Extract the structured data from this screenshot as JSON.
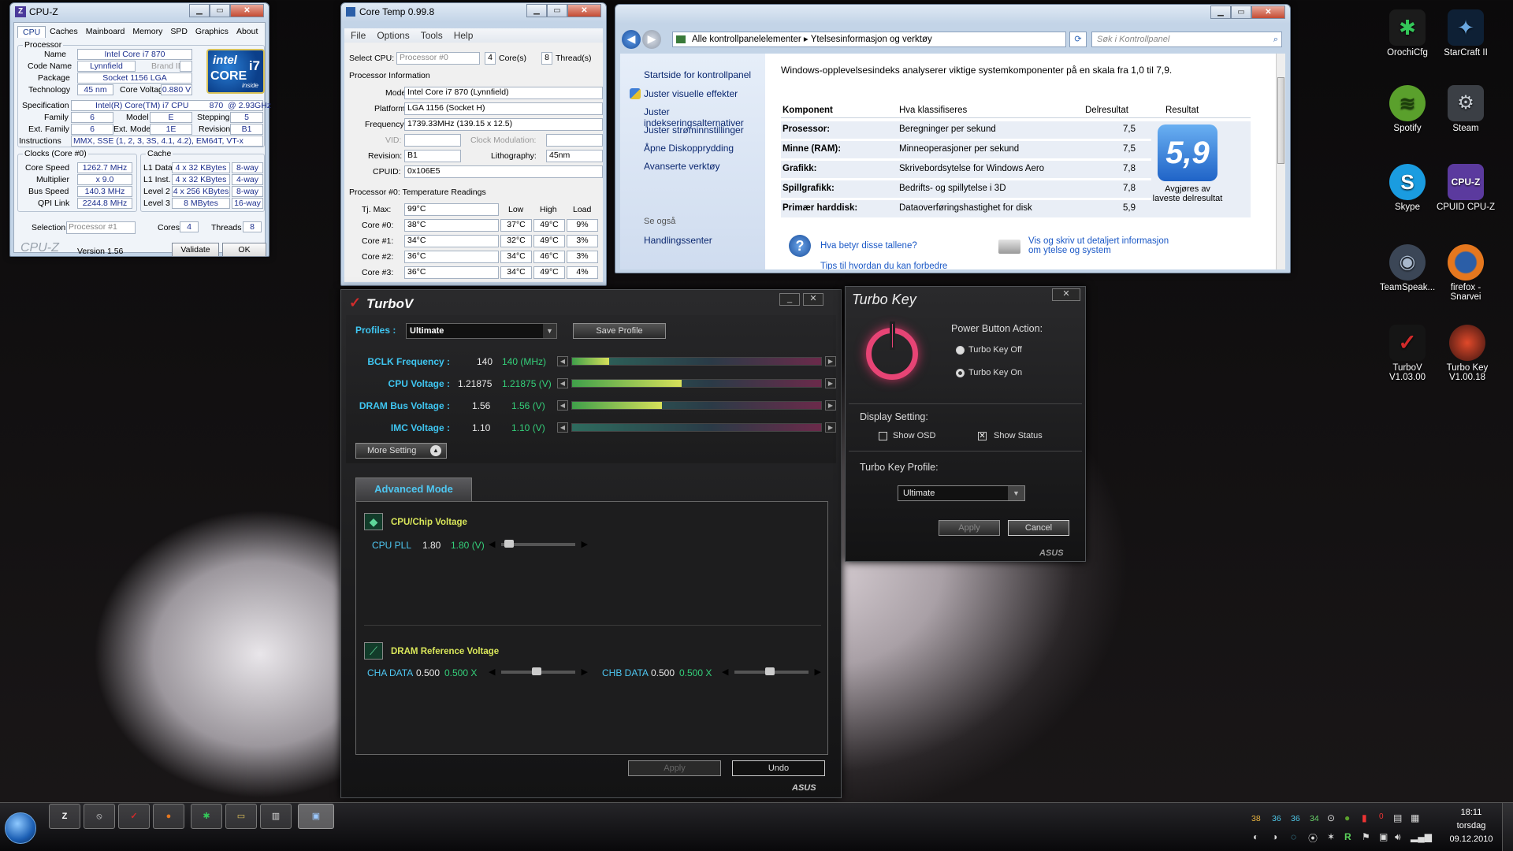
{
  "cpuz": {
    "title": "CPU-Z",
    "tabs": [
      "CPU",
      "Caches",
      "Mainboard",
      "Memory",
      "SPD",
      "Graphics",
      "About"
    ],
    "processor_group": "Processor",
    "name_l": "Name",
    "name": "Intel Core i7 870",
    "codename_l": "Code Name",
    "codename": "Lynnfield",
    "brandid_l": "Brand ID",
    "package_l": "Package",
    "package": "Socket 1156 LGA",
    "tech_l": "Technology",
    "tech": "45 nm",
    "cv_l": "Core Voltage",
    "cv": "0.880 V",
    "spec_l": "Specification",
    "spec": "Intel(R) Core(TM) i7 CPU         870  @ 2.93GHz",
    "family_l": "Family",
    "family": "6",
    "model_l": "Model",
    "model": "E",
    "stepping_l": "Stepping",
    "stepping": "5",
    "extfam_l": "Ext. Family",
    "extfam": "6",
    "extmodel_l": "Ext. Model",
    "extmodel": "1E",
    "rev_l": "Revision",
    "rev": "B1",
    "instr_l": "Instructions",
    "instr": "MMX, SSE (1, 2, 3, 3S, 4.1, 4.2), EM64T, VT-x",
    "clocks_group": "Clocks (Core #0)",
    "cs_l": "Core Speed",
    "cs": "1262.7 MHz",
    "mult_l": "Multiplier",
    "mult": "x 9.0",
    "bus_l": "Bus Speed",
    "bus": "140.3 MHz",
    "qpi_l": "QPI Link",
    "qpi": "2244.8 MHz",
    "cache_group": "Cache",
    "l1d_l": "L1 Data",
    "l1d": "4 x 32 KBytes",
    "l1d_w": "8-way",
    "l1i_l": "L1 Inst.",
    "l1i": "4 x 32 KBytes",
    "l1i_w": "4-way",
    "l2_l": "Level 2",
    "l2": "4 x 256 KBytes",
    "l2_w": "8-way",
    "l3_l": "Level 3",
    "l3": "8 MBytes",
    "l3_w": "16-way",
    "sel_l": "Selection",
    "sel": "Processor #1",
    "cores_l": "Cores",
    "cores": "4",
    "threads_l": "Threads",
    "threads": "8",
    "brand": "CPU-Z",
    "version": "Version 1.56",
    "validate": "Validate",
    "ok": "OK",
    "logo_intel": "intel",
    "logo_core": "CORE",
    "logo_i7": "i7",
    "logo_inside": "inside"
  },
  "coretemp": {
    "title": "Core Temp 0.99.8",
    "menu": [
      "File",
      "Options",
      "Tools",
      "Help"
    ],
    "selcpu_l": "Select CPU:",
    "selcpu": "Processor #0",
    "cores": "4",
    "cores_l": "Core(s)",
    "threads": "8",
    "threads_l": "Thread(s)",
    "pi_group": "Processor Information",
    "model_l": "Model:",
    "model": "Intel Core i7 870 (Lynnfield)",
    "platform_l": "Platform:",
    "platform": "LGA 1156 (Socket H)",
    "freq_l": "Frequency:",
    "freq": "1739.33MHz (139.15 x 12.5)",
    "vid_l": "VID:",
    "clockmod_l": "Clock Modulation:",
    "rev_l": "Revision:",
    "rev": "B1",
    "litho_l": "Lithography:",
    "litho": "45nm",
    "cpuid_l": "CPUID:",
    "cpuid": "0x106E5",
    "temp_group": "Processor #0: Temperature Readings",
    "tjmax_l": "Tj. Max:",
    "tjmax": "99°C",
    "h_low": "Low",
    "h_high": "High",
    "h_load": "Load",
    "rows": [
      {
        "l": "Core #0:",
        "t": "38°C",
        "lo": "37°C",
        "hi": "49°C",
        "ld": "9%"
      },
      {
        "l": "Core #1:",
        "t": "34°C",
        "lo": "32°C",
        "hi": "49°C",
        "ld": "3%"
      },
      {
        "l": "Core #2:",
        "t": "36°C",
        "lo": "34°C",
        "hi": "46°C",
        "ld": "3%"
      },
      {
        "l": "Core #3:",
        "t": "36°C",
        "lo": "34°C",
        "hi": "49°C",
        "ld": "4%"
      }
    ]
  },
  "cp": {
    "crumb1": "Alle kontrollpanelelementer",
    "crumb2": "Ytelsesinformasjon og verktøy",
    "search": "Søk i Kontrollpanel",
    "side": [
      "Startside for kontrollpanel",
      "Juster visuelle effekter",
      "Juster indekseringsalternativer",
      "Juster strøminnstillinger",
      "Åpne Diskopprydding",
      "Avanserte verktøy"
    ],
    "seealso": "Se også",
    "action": "Handlingssenter",
    "intro": "Windows-opplevelsesindeks analyserer viktige systemkomponenter på en skala fra 1,0 til 7,9.",
    "h1": "Komponent",
    "h2": "Hva klassifiseres",
    "h3": "Delresultat",
    "h4": "Resultat",
    "rows": [
      {
        "c": "Prosessor:",
        "d": "Beregninger per sekund",
        "s": "7,5"
      },
      {
        "c": "Minne (RAM):",
        "d": "Minneoperasjoner per sekund",
        "s": "7,5"
      },
      {
        "c": "Grafikk:",
        "d": "Skrivebordsytelse for Windows Aero",
        "s": "7,8"
      },
      {
        "c": "Spillgrafikk:",
        "d": "Bedrifts- og spillytelse i 3D",
        "s": "7,8"
      },
      {
        "c": "Primær harddisk:",
        "d": "Dataoverføringshastighet for disk",
        "s": "5,9"
      }
    ],
    "score": "5,9",
    "score_note": "Avgjøres av laveste delresultat",
    "link1": "Hva betyr disse tallene?",
    "link2": "Vis og skriv ut detaljert informasjon om ytelse og system",
    "link3": "Tips til hvordan du kan forbedre"
  },
  "turbov": {
    "title": "TurboV",
    "profiles_l": "Profiles :",
    "profile": "Ultimate",
    "save": "Save Profile",
    "rows": [
      {
        "l": "BCLK Frequency :",
        "v": "140",
        "g": "140  (MHz)",
        "f": 0.15
      },
      {
        "l": "CPU Voltage :",
        "v": "1.21875",
        "g": "1.21875  (V)",
        "f": 0.44
      },
      {
        "l": "DRAM Bus Voltage :",
        "v": "1.56",
        "g": "1.56  (V)",
        "f": 0.36
      },
      {
        "l": "IMC Voltage :",
        "v": "1.10",
        "g": "1.10  (V)",
        "f": 0.0
      }
    ],
    "more": "More Setting",
    "adv": "Advanced Mode",
    "cpu_group": "CPU/Chip Voltage",
    "pll_l": "CPU PLL",
    "pll": "1.80",
    "pll_g": "1.80  (V)",
    "dram_group": "DRAM Reference Voltage",
    "cha_l": "CHA DATA",
    "cha": "0.500",
    "cha_g": "0.500  X",
    "chb_l": "CHB DATA",
    "chb": "0.500",
    "chb_g": "0.500  X",
    "apply": "Apply",
    "undo": "Undo",
    "asus": "ASUS"
  },
  "turbokey": {
    "title": "Turbo Key",
    "pba": "Power Button Action:",
    "off": "Turbo Key Off",
    "on": "Turbo Key On",
    "display": "Display Setting:",
    "osd": "Show OSD",
    "status": "Show Status",
    "profile_l": "Turbo Key Profile:",
    "profile": "Ultimate",
    "apply": "Apply",
    "cancel": "Cancel",
    "asus": "ASUS"
  },
  "desktop": {
    "icons": [
      {
        "n": "OrochiCfg",
        "c": "#1b1b1b",
        "a": "#34c759"
      },
      {
        "n": "StarCraft II",
        "c": "#0e2035",
        "a": "#6aa7e0"
      },
      {
        "n": "Spotify",
        "c": "#5aa02c",
        "a": "#1a3e0a"
      },
      {
        "n": "Steam",
        "c": "#3b3f45",
        "a": "#c7cdd3"
      },
      {
        "n": "Skype",
        "c": "#1a9ce0",
        "a": "#fff"
      },
      {
        "n": "CPUID CPU-Z",
        "c": "#5b3a9e",
        "a": "#fff"
      },
      {
        "n": "TeamSpeak...",
        "c": "#3b4656",
        "a": "#a8b8cc"
      },
      {
        "n": "firefox - Snarvei",
        "c": "#e5771e",
        "a": "#2b5ea7"
      },
      {
        "n": "TurboV V1.03.00",
        "c": "#151515",
        "a": "#d22a2a"
      },
      {
        "n": "Turbo Key V1.00.18",
        "c": "#3b1410",
        "a": "#e0492a"
      }
    ]
  },
  "taskbar": {
    "temps": [
      "38",
      "36",
      "36",
      "34"
    ],
    "time": "18:11",
    "day": "torsdag",
    "date": "09.12.2010"
  }
}
